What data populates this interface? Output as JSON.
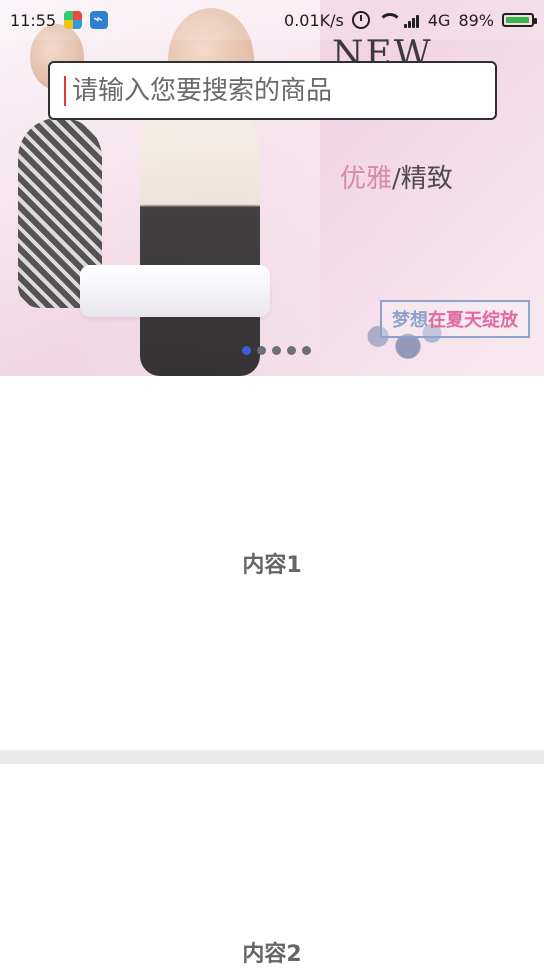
{
  "status_bar": {
    "time": "11:55",
    "network_speed": "0.01K/s",
    "network_type": "4G",
    "battery_percent": "89%",
    "battery_level": 0.89,
    "colors": {
      "battery_fill": "#39b54a"
    }
  },
  "banner": {
    "headline": "NEW",
    "subline": "",
    "tagline_main_1": "优雅",
    "tagline_separator": "/",
    "tagline_main_2": "精致",
    "promo_1": "梦想",
    "promo_2": "在夏天绽放",
    "indicator": {
      "count": 5,
      "active_index": 0
    }
  },
  "search": {
    "placeholder": "请输入您要搜索的商品",
    "value": ""
  },
  "content": [
    {
      "title": "内容1"
    },
    {
      "title": "内容2"
    }
  ]
}
